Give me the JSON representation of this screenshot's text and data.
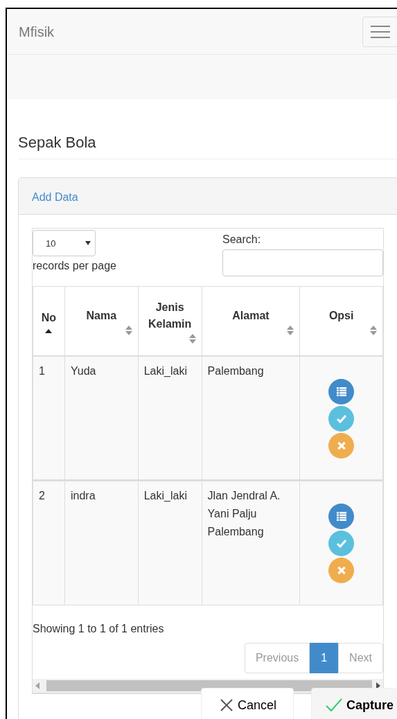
{
  "navbar": {
    "brand": "Mfisik"
  },
  "heading": "Sepak Bola",
  "panel": {
    "header_link": "Add Data",
    "length_select": {
      "value": "10"
    },
    "length_label": "records per page",
    "search": {
      "label": "Search:"
    },
    "table": {
      "columns": [
        {
          "label": "No",
          "sorted_ascending": true
        },
        {
          "label": "Nama",
          "sorted_ascending": false
        },
        {
          "label": "Jenis Kelamin",
          "sorted_ascending": false
        },
        {
          "label": "Alamat",
          "sorted_ascending": false
        },
        {
          "label": "Opsi",
          "sorted_ascending": false
        }
      ],
      "rows": [
        {
          "no": "1",
          "nama": "Yuda",
          "jenis_kelamin": "Laki_laki",
          "alamat": "Palembang",
          "options": [
            {
              "kind": "list"
            },
            {
              "kind": "check"
            },
            {
              "kind": "remove"
            }
          ]
        },
        {
          "no": "2",
          "nama": "indra",
          "jenis_kelamin": "Laki_laki",
          "alamat": "Jlan Jendral A. Yani Palju Palembang",
          "options": [
            {
              "kind": "list"
            },
            {
              "kind": "check"
            },
            {
              "kind": "remove"
            }
          ]
        }
      ]
    },
    "info": "Showing 1 to 1 of 1 entries",
    "pagination": [
      {
        "label": "Previous",
        "selected": false
      },
      {
        "label": "1",
        "selected": true
      },
      {
        "label": "Next",
        "selected": false
      }
    ]
  },
  "actions": [
    {
      "label": "Cancel",
      "kind": "cancel"
    },
    {
      "label": "Capture",
      "kind": "capture"
    }
  ]
}
